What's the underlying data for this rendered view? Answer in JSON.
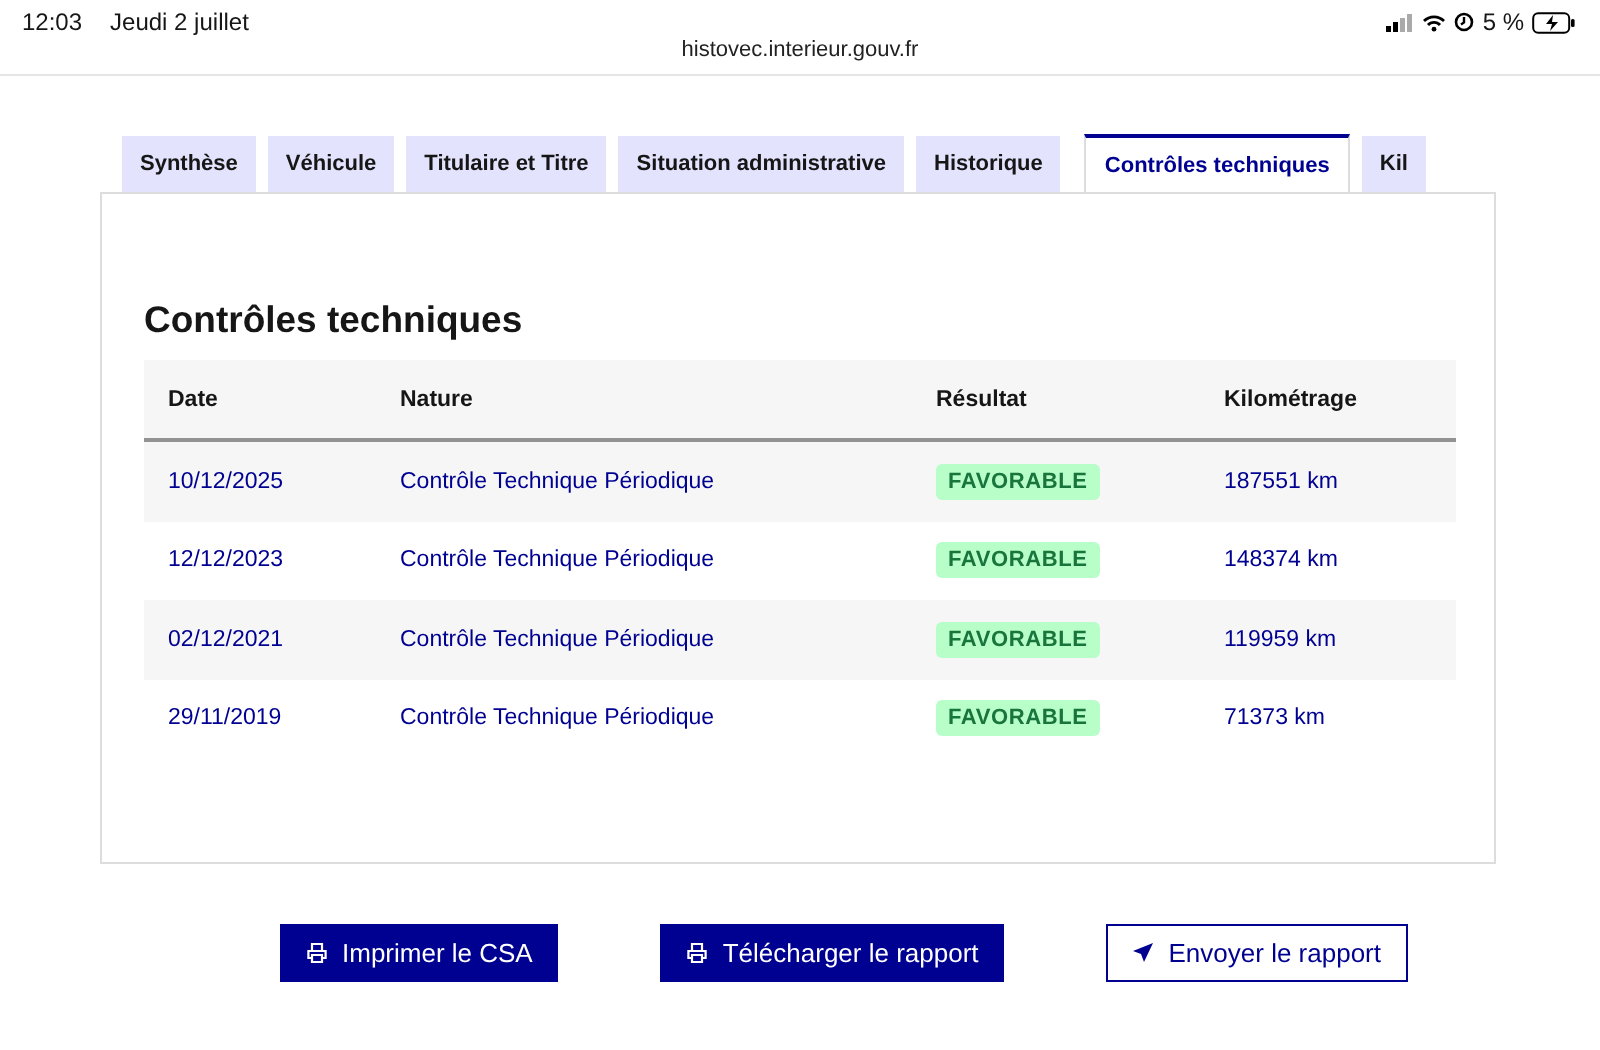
{
  "status_bar": {
    "time": "12:03",
    "date": "Jeudi 2 juillet",
    "battery": "5 %"
  },
  "address_bar": {
    "url": "histovec.interieur.gouv.fr"
  },
  "tabs": [
    {
      "label": "Synthèse",
      "selected": false
    },
    {
      "label": "Véhicule",
      "selected": false
    },
    {
      "label": "Titulaire et Titre",
      "selected": false
    },
    {
      "label": "Situation administrative",
      "selected": false
    },
    {
      "label": "Historique",
      "selected": false
    },
    {
      "label": "Contrôles techniques",
      "selected": true
    },
    {
      "label": "Kil",
      "selected": false
    }
  ],
  "section": {
    "title": "Contrôles techniques"
  },
  "table": {
    "columns": [
      "Date",
      "Nature",
      "Résultat",
      "Kilométrage"
    ],
    "rows": [
      {
        "date": "10/12/2025",
        "nature": "Contrôle Technique Périodique",
        "result": "FAVORABLE",
        "mileage": "187551 km"
      },
      {
        "date": "12/12/2023",
        "nature": "Contrôle Technique Périodique",
        "result": "FAVORABLE",
        "mileage": "148374 km"
      },
      {
        "date": "02/12/2021",
        "nature": "Contrôle Technique Périodique",
        "result": "FAVORABLE",
        "mileage": "119959 km"
      },
      {
        "date": "29/11/2019",
        "nature": "Contrôle Technique Périodique",
        "result": "FAVORABLE",
        "mileage": "71373 km"
      }
    ]
  },
  "actions": [
    {
      "label": "Imprimer le CSA",
      "kind": "print"
    },
    {
      "label": "Télécharger le rapport",
      "kind": "print"
    },
    {
      "label": "Envoyer le rapport",
      "kind": "send"
    }
  ]
}
